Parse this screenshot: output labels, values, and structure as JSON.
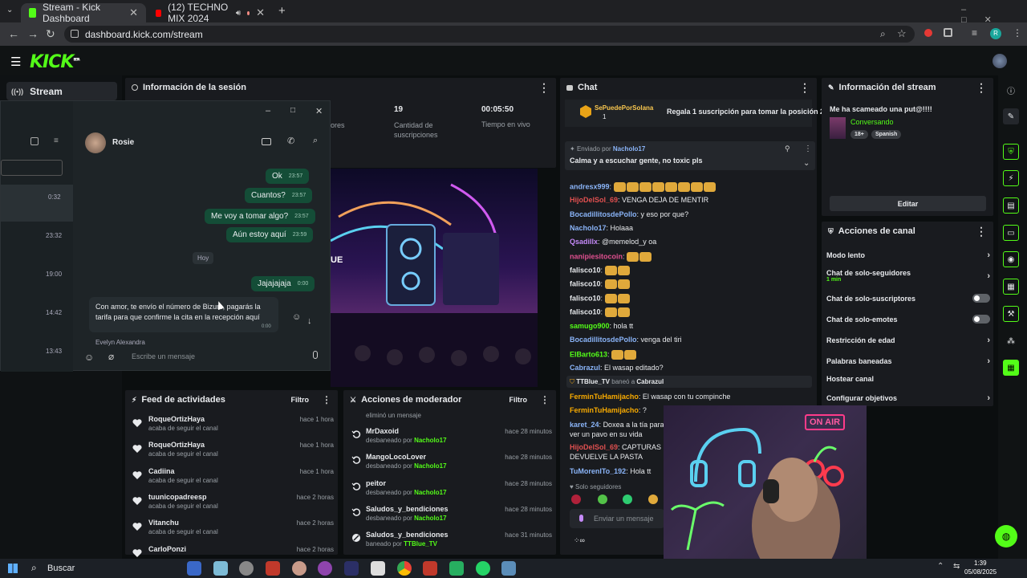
{
  "browser": {
    "tabs": [
      {
        "title": "Stream - Kick Dashboard",
        "active": true
      },
      {
        "title": "(12) TECHNO MIX 2024",
        "active": false
      }
    ],
    "url": "dashboard.kick.com/stream"
  },
  "kick": {
    "logo": "KICK",
    "logo_sup": "BETA",
    "nav_stream": "Stream"
  },
  "session": {
    "title": "Información de la sesión",
    "partial_label": "ores",
    "subs_value": "19",
    "subs_label": "Cantidad de suscripciones",
    "time_value": "00:05:50",
    "time_label": "Tiempo en vivo"
  },
  "whatsapp": {
    "contact": "Rosie",
    "list_times": [
      "0:32",
      "23:32",
      "19:00",
      "14:42",
      "13:43"
    ],
    "messages": [
      {
        "text": "Ok",
        "time": "23:57"
      },
      {
        "text": "Cuantos?",
        "time": "23:57"
      },
      {
        "text": "Me voy a tomar algo?",
        "time": "23:57"
      },
      {
        "text": "Aún estoy aquí",
        "time": "23:59"
      },
      {
        "text": "Jajajajaja",
        "time": "0:00"
      }
    ],
    "day_label": "Hoy",
    "incoming_1": "Con amor, te envío el número de Bizum, pagarás la",
    "incoming_2": "tarifa para que confirme la cita en la recepción aquí",
    "incoming_time": "0:00",
    "next_sender": "Evelyn Alexandra",
    "input_placeholder": "Escribe un mensaje"
  },
  "chat": {
    "title": "Chat",
    "pinned_gift_user": "SePuedePorSolana",
    "pinned_gift_count": "1",
    "pinned_gift_text": "Regala 1 suscripción para tomar la posición 2",
    "pinned_by_label": "Enviado por",
    "pinned_by_user": "Nacholo17",
    "pinned_msg": "Calma y a escuchar gente, no toxic pls",
    "lines": [
      {
        "user": "andresx999",
        "color": "#8ab4f8",
        "text": ""
      },
      {
        "user": "HijoDelSol_69",
        "color": "#e05050",
        "text": "VENGA DEJA DE MENTIR"
      },
      {
        "user": "BocadillitosdePollo",
        "color": "#8ab4f8",
        "text": "y eso por que?"
      },
      {
        "user": "Nacholo17",
        "color": "#8ab4f8",
        "text": "Holaaa"
      },
      {
        "user": "Qsadillx",
        "color": "#c58af9",
        "text": "@memelod_y oa"
      },
      {
        "user": "nanipiesitocoin",
        "color": "#e05090",
        "text": ""
      },
      {
        "user": "falisco10",
        "color": "#e8eaed",
        "text": ""
      },
      {
        "user": "falisco10",
        "color": "#e8eaed",
        "text": ""
      },
      {
        "user": "falisco10",
        "color": "#e8eaed",
        "text": ""
      },
      {
        "user": "falisco10",
        "color": "#e8eaed",
        "text": ""
      },
      {
        "user": "samugo900",
        "color": "#53fc18",
        "text": "hola tt"
      },
      {
        "user": "BocadillitosdePollo",
        "color": "#8ab4f8",
        "text": "venga del tiri"
      },
      {
        "user": "ElBarto613",
        "color": "#53fc18",
        "text": ""
      },
      {
        "user": "Cabrazul",
        "color": "#8ab4f8",
        "text": "El wasap editado?"
      }
    ],
    "ban_notice_mod": "TTBlue_TV",
    "ban_notice_text": "baneó a",
    "ban_notice_user": "Cabrazul",
    "lines2": [
      {
        "user": "FerminTuHamijacho",
        "color": "#f9ab00",
        "text": "El wasap con tu compinche"
      },
      {
        "user": "FerminTuHamijacho",
        "color": "#f9ab00",
        "text": "?"
      },
      {
        "user": "karet_24",
        "color": "#8ab4f8",
        "text": "Doxea a la tía para qu"
      },
      {
        "user": "",
        "color": "#e8eaed",
        "text": "ver un pavo en su vida"
      },
      {
        "user": "HijoDelSol_69",
        "color": "#e05050",
        "text": "CAPTURAS DE"
      },
      {
        "user": "",
        "color": "#e8eaed",
        "text": "DEVUELVE LA PASTA"
      },
      {
        "user": "TuMorenITo_192",
        "color": "#8ab4f8",
        "text": "Hola tt"
      }
    ],
    "followers_only": "Solo seguidores",
    "input_placeholder": "Enviar un mensaje"
  },
  "activity": {
    "title": "Feed de actividades",
    "filter": "Filtro",
    "items": [
      {
        "name": "RoqueOrtizHaya",
        "sub": "acaba de seguir el canal",
        "time": "hace 1 hora"
      },
      {
        "name": "RoqueOrtizHaya",
        "sub": "acaba de seguir el canal",
        "time": "hace 1 hora"
      },
      {
        "name": "Cadiina",
        "sub": "acaba de seguir el canal",
        "time": "hace 1 hora"
      },
      {
        "name": "tuunicopadreesp",
        "sub": "acaba de seguir el canal",
        "time": "hace 2 horas"
      },
      {
        "name": "Vitanchu",
        "sub": "acaba de seguir el canal",
        "time": "hace 2 horas"
      },
      {
        "name": "CarloPonzi",
        "sub": "",
        "time": "hace 2 horas"
      }
    ]
  },
  "modactions": {
    "title": "Acciones de moderador",
    "filter": "Filtro",
    "first_line": "eliminó un mensaje",
    "items": [
      {
        "name": "MrDaxoid",
        "sub": "desbaneado por",
        "by": "Nacholo17",
        "time": "hace 28 minutos"
      },
      {
        "name": "MangoLocoLover",
        "sub": "desbaneado por",
        "by": "Nacholo17",
        "time": "hace 28 minutos"
      },
      {
        "name": "peitor",
        "sub": "desbaneado por",
        "by": "Nacholo17",
        "time": "hace 28 minutos"
      },
      {
        "name": "Saludos_y_bendiciones",
        "sub": "desbaneado por",
        "by": "Nacholo17",
        "time": "hace 28 minutos"
      },
      {
        "name": "Saludos_y_bendiciones",
        "sub": "baneado por",
        "by": "TTBlue_TV",
        "time": "hace 31 minutos"
      }
    ]
  },
  "stream_info": {
    "title": "Información del stream",
    "stream_title": "Me ha scameado una put@!!!!",
    "category": "Conversando",
    "tag_age": "18+",
    "tag_lang": "Spanish",
    "edit": "Editar"
  },
  "channel_actions": {
    "title": "Acciones de canal",
    "items": [
      {
        "label": "Modo lento",
        "kind": "chevron",
        "sub": ""
      },
      {
        "label": "Chat de solo-seguidores",
        "kind": "chevron",
        "sub": "1 min"
      },
      {
        "label": "Chat de solo-suscriptores",
        "kind": "toggle",
        "sub": ""
      },
      {
        "label": "Chat de solo-emotes",
        "kind": "toggle",
        "sub": ""
      },
      {
        "label": "Restricción de edad",
        "kind": "chevron",
        "sub": ""
      },
      {
        "label": "Palabras baneadas",
        "kind": "chevron",
        "sub": ""
      },
      {
        "label": "Hostear canal",
        "kind": "none",
        "sub": ""
      },
      {
        "label": "Configurar objetivos",
        "kind": "chevron",
        "sub": ""
      }
    ]
  },
  "overlay": {
    "on_air": "ON AIR",
    "preview_text": "UE"
  },
  "taskbar": {
    "search": "Buscar",
    "time": "1:39",
    "date": "05/08/2025"
  },
  "colors": {
    "kick_green": "#53fc18",
    "panel": "#191b1f",
    "whatsapp_out": "#144d37"
  }
}
